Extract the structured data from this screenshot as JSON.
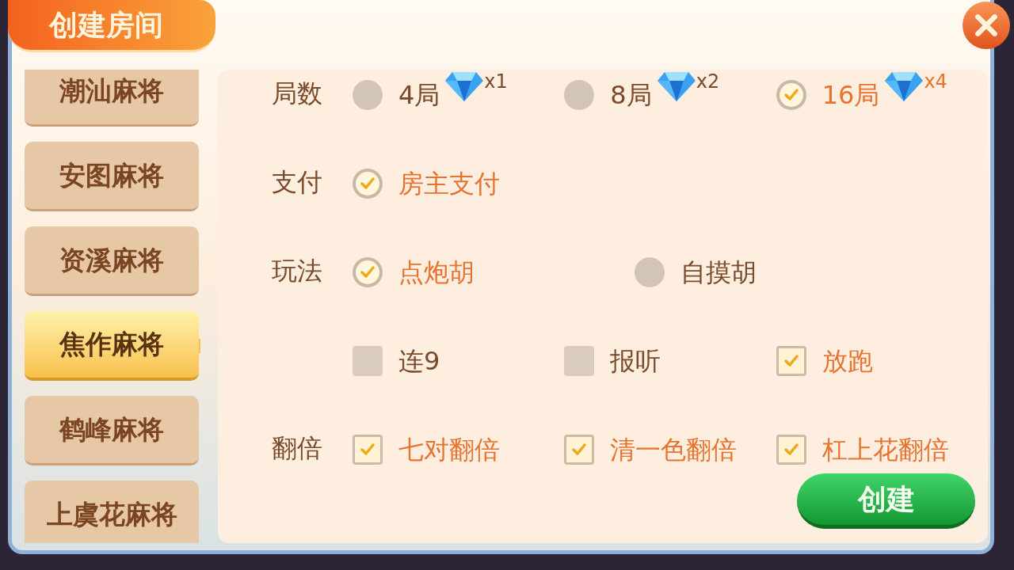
{
  "title": "创建房间",
  "games": [
    {
      "label": "潮汕麻将",
      "selected": false
    },
    {
      "label": "安图麻将",
      "selected": false
    },
    {
      "label": "资溪麻将",
      "selected": false
    },
    {
      "label": "焦作麻将",
      "selected": true
    },
    {
      "label": "鹤峰麻将",
      "selected": false
    },
    {
      "label": "上虞花麻将",
      "selected": false
    }
  ],
  "rows": [
    {
      "label": "局数",
      "options": [
        {
          "kind": "radio",
          "label": "4局",
          "checked": false,
          "cost": "x1"
        },
        {
          "kind": "radio",
          "label": "8局",
          "checked": false,
          "cost": "x2"
        },
        {
          "kind": "radio",
          "label": "16局",
          "checked": true,
          "cost": "x4"
        }
      ]
    },
    {
      "label": "支付",
      "options": [
        {
          "kind": "radio",
          "label": "房主支付",
          "checked": true
        }
      ]
    },
    {
      "label": "玩法",
      "options": [
        {
          "kind": "radio",
          "label": "点炮胡",
          "checked": true
        },
        {
          "kind": "radio",
          "label": "自摸胡",
          "checked": false
        }
      ]
    },
    {
      "options": [
        {
          "kind": "checkbox",
          "label": "连9",
          "checked": false
        },
        {
          "kind": "checkbox",
          "label": "报听",
          "checked": false
        },
        {
          "kind": "checkbox",
          "label": "放跑",
          "checked": true
        }
      ]
    },
    {
      "label": "翻倍",
      "options": [
        {
          "kind": "checkbox",
          "label": "七对翻倍",
          "checked": true
        },
        {
          "kind": "checkbox",
          "label": "清一色翻倍",
          "checked": true
        },
        {
          "kind": "checkbox",
          "label": "杠上花翻倍",
          "checked": true
        }
      ]
    }
  ],
  "create_button": "创建"
}
